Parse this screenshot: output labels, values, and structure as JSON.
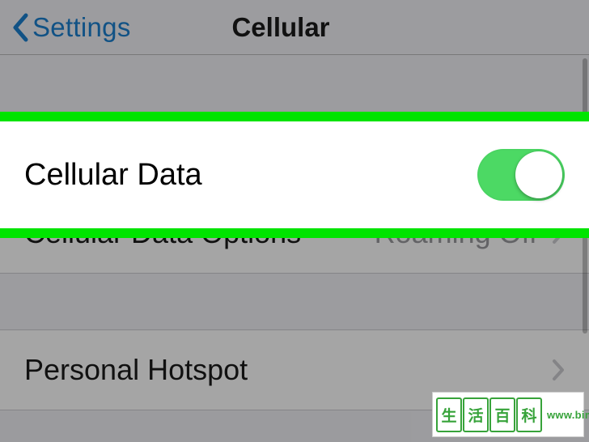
{
  "header": {
    "back_label": "Settings",
    "title": "Cellular"
  },
  "rows": {
    "cellular_data": {
      "label": "Cellular Data",
      "toggle_on": true
    },
    "options": {
      "label": "Cellular Data Options",
      "value": "Roaming Off"
    },
    "hotspot": {
      "label": "Personal Hotspot"
    }
  },
  "watermark": {
    "chars": [
      "生",
      "活",
      "百",
      "科"
    ],
    "url": "www.bimeiz.com"
  }
}
